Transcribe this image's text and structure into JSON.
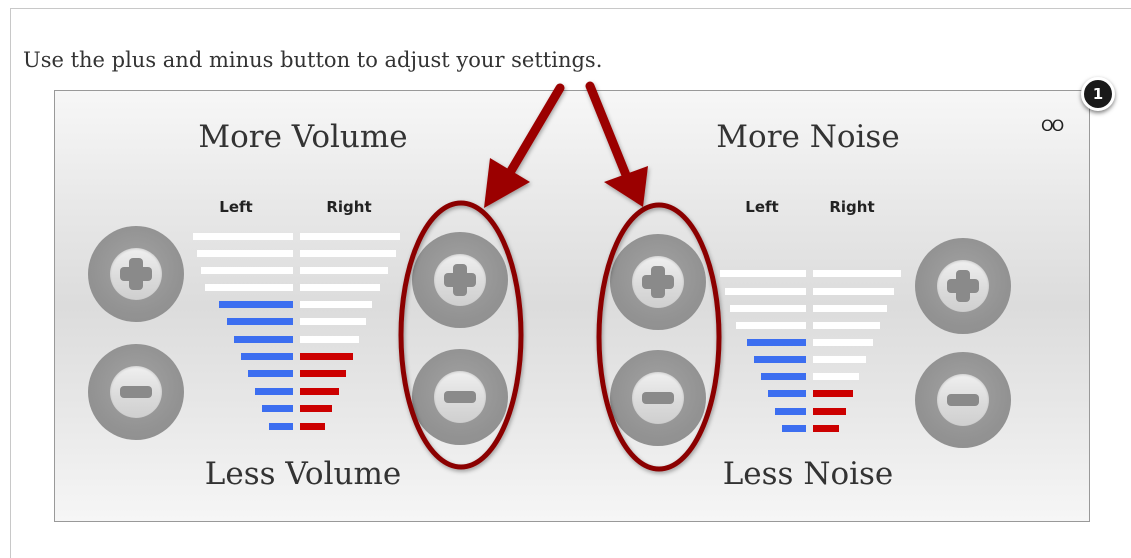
{
  "instruction": "Use the plus and minus button to adjust your settings.",
  "callout_badge": "1",
  "corner_icon": "OO",
  "volume": {
    "top_label": "More Volume",
    "bottom_label": "Less Volume",
    "left_label": "Left",
    "right_label": "Right"
  },
  "noise": {
    "top_label": "More Noise",
    "bottom_label": "Less Noise",
    "left_label": "Left",
    "right_label": "Right"
  },
  "colors": {
    "level_active_left": "#3c6ef0",
    "level_active_right": "#cc0000",
    "level_inactive": "#ffffff",
    "highlight": "#8b0000"
  },
  "icons": [
    "plus-icon",
    "minus-icon",
    "glasses-icon",
    "arrow-icon"
  ]
}
